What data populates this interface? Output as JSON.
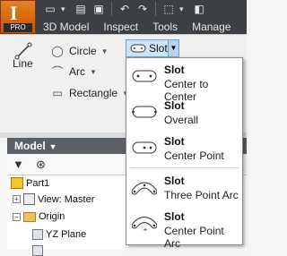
{
  "quick_access": {
    "icons": [
      "new-file-icon",
      "open-icon",
      "save-icon",
      "undo-icon",
      "redo-icon",
      "select-icon"
    ]
  },
  "app_button": {
    "badge": "PRO"
  },
  "ribbon_tabs": [
    "3D Model",
    "Inspect",
    "Tools",
    "Manage"
  ],
  "ribbon": {
    "line_label": "Line",
    "circle_label": "Circle",
    "arc_label": "Arc",
    "rectangle_label": "Rectangle",
    "slot_label": "Slot"
  },
  "slot_menu": {
    "items": [
      {
        "title": "Slot",
        "subtitle": "Center to Center"
      },
      {
        "title": "Slot",
        "subtitle": "Overall"
      },
      {
        "title": "Slot",
        "subtitle": "Center Point"
      },
      {
        "title": "Slot",
        "subtitle": "Three Point Arc"
      },
      {
        "title": "Slot",
        "subtitle": "Center Point Arc"
      }
    ]
  },
  "browser": {
    "header": "Model",
    "tree": [
      {
        "label": "Part1"
      },
      {
        "label": "View: Master"
      },
      {
        "label": "Origin"
      },
      {
        "label": "YZ Plane"
      }
    ]
  },
  "colors": {
    "title_bar": "#3c3f44",
    "app_button": "#e8821e",
    "slot_highlight": "#cfe4f6",
    "browser_header": "#5a6066"
  }
}
